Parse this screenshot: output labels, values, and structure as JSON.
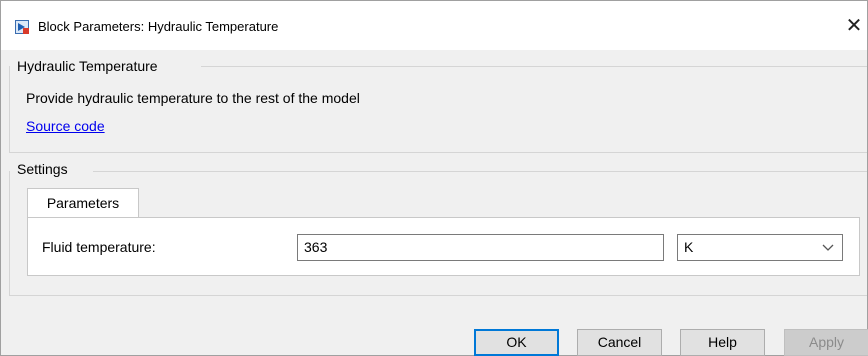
{
  "window": {
    "title": "Block Parameters: Hydraulic Temperature",
    "icon": "simulink-block-icon",
    "close_glyph": "✕"
  },
  "description_group": {
    "title": "Hydraulic Temperature",
    "text": "Provide hydraulic temperature to the rest of the model",
    "link_label": "Source code"
  },
  "settings_group": {
    "title": "Settings",
    "tabs": [
      {
        "label": "Parameters",
        "selected": true
      }
    ],
    "parameters": [
      {
        "label": "Fluid temperature:",
        "value": "363",
        "unit": "K"
      }
    ]
  },
  "buttons": {
    "ok": "OK",
    "cancel": "Cancel",
    "help": "Help",
    "apply": "Apply"
  },
  "colors": {
    "link": "#0000ee",
    "primary_border": "#0078d7"
  }
}
